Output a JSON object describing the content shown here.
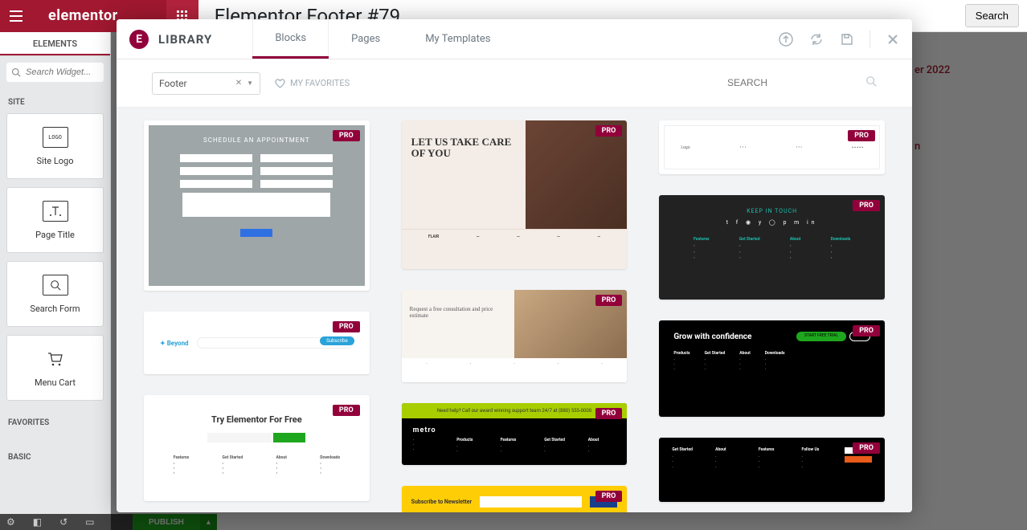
{
  "header": {
    "brand": "elementor",
    "title": "Elementor Footer #79",
    "search_btn": "Search"
  },
  "sidebar": {
    "tab": "ELEMENTS",
    "search_placeholder": "Search Widget...",
    "categories": {
      "site": "SITE",
      "favorites": "FAVORITES",
      "basic": "BASIC"
    },
    "widgets": [
      {
        "label": "Site Logo",
        "icon": "logo"
      },
      {
        "label": "Page Title",
        "icon": "title"
      },
      {
        "label": "Search Form",
        "icon": "search"
      },
      {
        "label": "Menu Cart",
        "icon": "cart"
      }
    ]
  },
  "bottombar": {
    "publish": "PUBLISH"
  },
  "right_col": {
    "line1": "er 2022",
    "line2": "n"
  },
  "modal": {
    "title": "LIBRARY",
    "tabs": {
      "blocks": "Blocks",
      "pages": "Pages",
      "my_templates": "My Templates"
    },
    "category_value": "Footer",
    "favorites": "MY FAVORITES",
    "search_placeholder": "SEARCH",
    "pro_badge": "PRO",
    "thumbs": {
      "t1_title": "SCHEDULE AN APPOINTMENT",
      "t2_title": "LET US TAKE CARE OF YOU",
      "t2_brand": "FLAIR",
      "t4_title": "KEEP IN TOUCH",
      "t5_brand": "Beyond",
      "t6_title": "Request a free consultation and price estimate",
      "t7_title": "Try Elementor For Free",
      "t8_bar": "Need help? Call our award winning support team 24/7 at (880) 555-0000",
      "t8_brand": "metro",
      "t9_title": "Grow with confidence",
      "t9_btn1": "START FREE TRIAL",
      "t11_title": "Subscribe to Newsletter",
      "col_products": "Products",
      "col_features": "Features",
      "col_getstarted": "Get Started",
      "col_about": "About",
      "col_downloads": "Downloads",
      "col_followus": "Follow Us"
    }
  }
}
